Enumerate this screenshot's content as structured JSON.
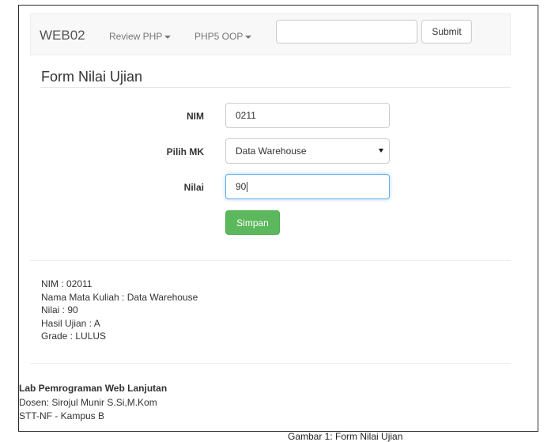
{
  "navbar": {
    "brand": "WEB02",
    "menu": [
      "Review PHP",
      "PHP5 OOP"
    ],
    "search_value": "",
    "submit_label": "Submit"
  },
  "form": {
    "title": "Form Nilai Ujian",
    "nim_label": "NIM",
    "nim_value": "0211",
    "mk_label": "Pilih MK",
    "mk_selected": "Data Warehouse",
    "nilai_label": "Nilai",
    "nilai_value": "90",
    "save_label": "Simpan"
  },
  "result": [
    "NIM : 02011",
    "Nama Mata Kuliah : Data Warehouse",
    "Nilai : 90",
    "Hasil Ujian : A",
    "Grade : LULUS"
  ],
  "footer": {
    "title": "Lab Pemrograman Web Lanjutan",
    "lines": [
      "Dosen: Sirojul Munir S.Si,M.Kom",
      "STT-NF - Kampus B"
    ]
  },
  "caption": "Gambar 1: Form Nilai Ujian"
}
